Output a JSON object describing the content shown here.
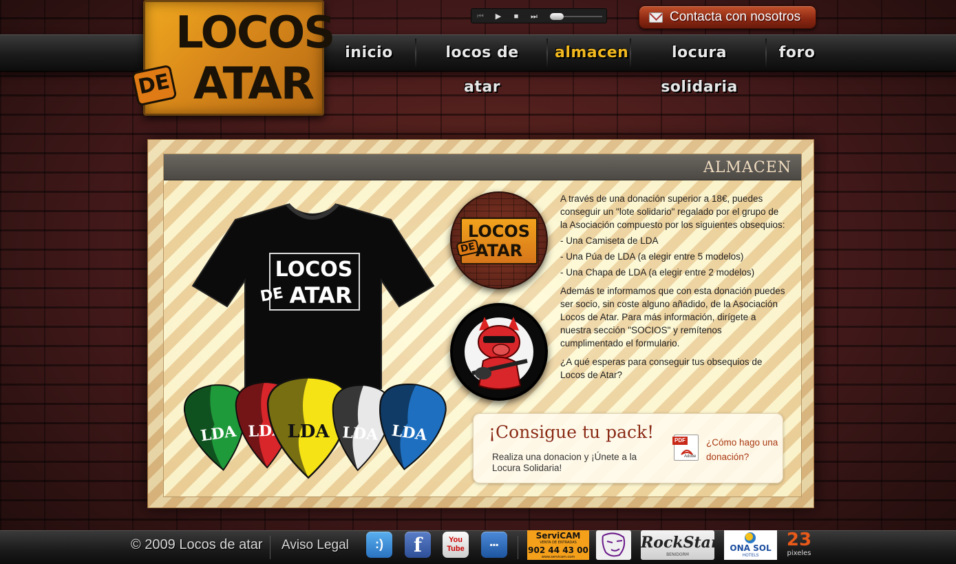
{
  "site": {
    "logo_top": "LOCOS",
    "logo_de": "DE",
    "logo_bottom": "ATAR"
  },
  "nav": {
    "items": [
      {
        "label": "inicio"
      },
      {
        "label": "locos de atar"
      },
      {
        "label": "almacen",
        "active": true
      },
      {
        "label": "locura solidaria"
      },
      {
        "label": "foro"
      }
    ]
  },
  "player": {
    "buttons": [
      "previous-icon",
      "play-icon",
      "stop-icon",
      "next-icon"
    ],
    "progress": 0
  },
  "contact": {
    "label": "Contacta con nosotros",
    "icon": "mail-icon"
  },
  "main": {
    "section_title": "ALMACEN",
    "tshirt_logo_top": "LOCOS",
    "tshirt_logo_de": "DE",
    "tshirt_logo_bottom": "ATAR",
    "picks": [
      {
        "label": "LDA",
        "color": "#1f9a3a"
      },
      {
        "label": "LDA",
        "color": "#d8262a"
      },
      {
        "label": "LDA",
        "color": "#f5e316"
      },
      {
        "label": "LDA",
        "color": "#e8e8e8"
      },
      {
        "label": "LDA",
        "color": "#1e6fc0"
      }
    ],
    "badge_logo_top": "LOCOS",
    "badge_logo_de": "DE",
    "badge_logo_bottom": "ATAR",
    "paragraph_1": "A través de una donación superior a 18€, puedes conseguir un \"lote solidario\" regalado por el grupo de la Asociación compuesto por los siguientes obsequios:",
    "list": [
      "- Una Camiseta de LDA",
      "- Una Púa de LDA (a elegir entre 5 modelos)",
      "- Una Chapa de LDA (a elegir entre 2 modelos)"
    ],
    "paragraph_2": "Además te informamos que con esta donación puedes ser socio, sin coste alguno añadido, de la Asociación Locos de Atar. Para más información, dirígete a nuestra sección \"SOCIOS\" y remítenos cumplimentado el formulario.",
    "paragraph_3": "¿A qué esperas para conseguir tus obsequios de Locos de Atar?"
  },
  "pack": {
    "title": "¡Consigue tu pack!",
    "subtitle": "Realiza una donacion y ¡Únete a la Locura Solidaria!",
    "pdf_tag": "PDF",
    "pdf_brand": "Adobe",
    "link": "¿Cómo hago una donación?"
  },
  "footer": {
    "copyright": "© 2009  Locos de atar",
    "legal": "Aviso Legal",
    "social": [
      {
        "icon": "tuenti-icon",
        "glyph": ":)",
        "color": "#3a8fd8"
      },
      {
        "icon": "facebook-icon",
        "glyph": "f",
        "color": "#3b5fa8"
      },
      {
        "icon": "youtube-icon",
        "glyph": "You Tube",
        "color": "#e8e8e8"
      },
      {
        "icon": "myspace-icon",
        "glyph": "▪▪▪",
        "color": "#2a6ab0"
      }
    ],
    "sponsors": {
      "servicam_name": "ServiCAM",
      "servicam_tag": "VENTA DE ENTRADAS",
      "servicam_phone": "902 44 43 00",
      "servicam_url": "www.servicam.com",
      "rockstar_name": "RockStar",
      "rockstar_city": "BENIDORM",
      "onasol_name": "ONA SOL",
      "onasol_sub": "HOTELS",
      "pixeles_num": "23",
      "pixeles_word": "pixeles"
    }
  }
}
